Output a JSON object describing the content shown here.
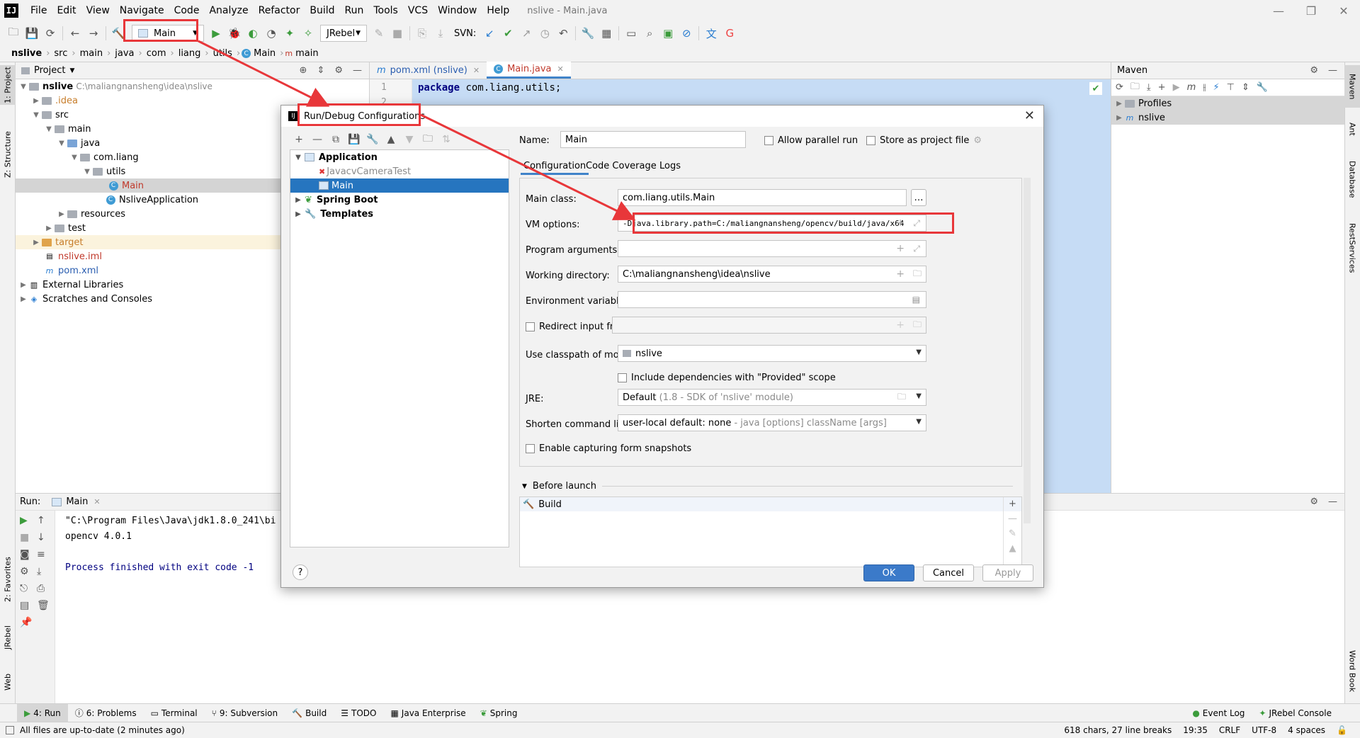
{
  "window": {
    "title": "nslive - Main.java"
  },
  "menu": [
    "File",
    "Edit",
    "View",
    "Navigate",
    "Code",
    "Analyze",
    "Refactor",
    "Build",
    "Run",
    "Tools",
    "VCS",
    "Window",
    "Help"
  ],
  "toolbar": {
    "run_config": "Main",
    "jrebel": "JRebel",
    "svn_label": "SVN:"
  },
  "breadcrumb": [
    "nslive",
    "src",
    "main",
    "java",
    "com",
    "liang",
    "utils",
    "Main",
    "main"
  ],
  "left_strip": {
    "project": "1: Project",
    "structure": "Z: Structure",
    "favorites": "2: Favorites",
    "jrebel": "JRebel",
    "web": "Web"
  },
  "right_strip": {
    "maven": "Maven",
    "ant": "Ant",
    "database": "Database",
    "rest": "RestServices",
    "wordbook": "Word Book"
  },
  "project_panel": {
    "title": "Project",
    "root_name": "nslive",
    "root_path": "C:\\maliangnansheng\\idea\\nslive",
    "nodes": {
      "idea": ".idea",
      "src": "src",
      "main": "main",
      "java": "java",
      "comliang": "com.liang",
      "utils": "utils",
      "main_class": "Main",
      "nslive_app": "NsliveApplication",
      "resources": "resources",
      "test": "test",
      "target": "target",
      "iml": "nslive.iml",
      "pom": "pom.xml",
      "ext_libs": "External Libraries",
      "scratches": "Scratches and Consoles"
    }
  },
  "editor": {
    "tabs": [
      "pom.xml (nslive)",
      "Main.java"
    ],
    "line1": "1",
    "line2": "2",
    "code_kw": "package",
    "code_rest": " com.liang.utils;"
  },
  "maven": {
    "title": "Maven",
    "profiles": "Profiles",
    "project": "nslive"
  },
  "run_panel": {
    "label": "Run:",
    "tab": "Main",
    "out_line1": "\"C:\\Program Files\\Java\\jdk1.8.0_241\\bi",
    "out_line2": "opencv  4.0.1",
    "out_line3": "Process finished with exit code -1"
  },
  "bottom_tabs": [
    "4: Run",
    "6: Problems",
    "Terminal",
    "9: Subversion",
    "Build",
    "TODO",
    "Java Enterprise",
    "Spring"
  ],
  "bottom_right": [
    "Event Log",
    "JRebel Console"
  ],
  "status": {
    "message": "All files are up-to-date (2 minutes ago)",
    "chars": "618 chars, 27 line breaks",
    "pos": "19:35",
    "crlf": "CRLF",
    "enc": "UTF-8",
    "indent": "4 spaces"
  },
  "dialog": {
    "title": "Run/Debug Configurations",
    "tree": {
      "application": "Application",
      "javacv": "JavacvCameraTest",
      "main": "Main",
      "spring_boot": "Spring Boot",
      "templates": "Templates"
    },
    "name_label": "Name:",
    "name_value": "Main",
    "allow_parallel": "Allow parallel run",
    "store_project": "Store as project file",
    "tabs": [
      "Configuration",
      "Code Coverage",
      "Logs"
    ],
    "main_class_label": "Main class:",
    "main_class_value": "com.liang.utils.Main",
    "vm_label": "VM options:",
    "vm_value": "-Djava.library.path=C:/maliangnansheng/opencv/build/java/x64",
    "prog_args_label": "Program arguments:",
    "workdir_label": "Working directory:",
    "workdir_value": "C:\\maliangnansheng\\idea\\nslive",
    "env_label": "Environment variables:",
    "redirect_label": "Redirect input from:",
    "classpath_label": "Use classpath of module:",
    "classpath_value": "nslive",
    "include_deps": "Include dependencies with \"Provided\" scope",
    "jre_label": "JRE:",
    "jre_value": "Default",
    "jre_hint": "(1.8 - SDK of 'nslive' module)",
    "shorten_label": "Shorten command line:",
    "shorten_value": "user-local default: none",
    "shorten_hint": "- java [options] className [args]",
    "snapshots": "Enable capturing form snapshots",
    "before_launch": "Before launch",
    "build_task": "Build",
    "ok": "OK",
    "cancel": "Cancel",
    "apply": "Apply",
    "help": "?"
  },
  "colors": {
    "annotation_red": "#e8373a",
    "selection_blue": "#2675bf",
    "editor_selection": "#c6dcf5"
  }
}
